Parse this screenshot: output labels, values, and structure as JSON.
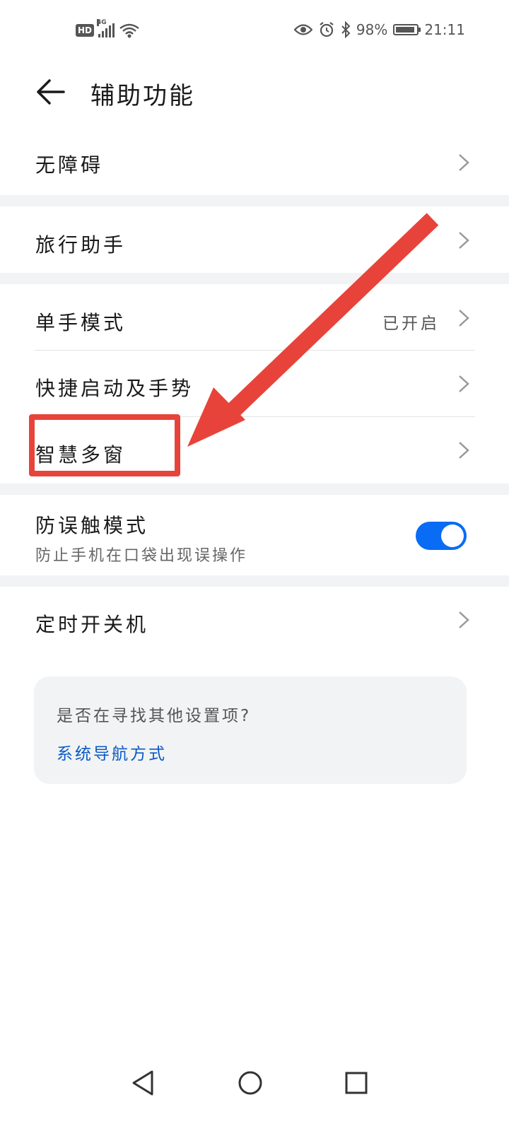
{
  "status_bar": {
    "hd": "HD",
    "network": "4G",
    "battery_percent": "98%",
    "time": "21:11"
  },
  "header": {
    "title": "辅助功能"
  },
  "groups": {
    "accessibility": "无障碍",
    "travel_assistant": "旅行助手",
    "one_hand_mode": {
      "label": "单手模式",
      "status": "已开启"
    },
    "shortcuts_gestures": "快捷启动及手势",
    "smart_multiwindow": "智慧多窗",
    "pocket_mode": {
      "label": "防误触模式",
      "description": "防止手机在口袋出现误操作",
      "enabled": true
    },
    "scheduled_power": "定时开关机"
  },
  "suggestion_card": {
    "question": "是否在寻找其他设置项?",
    "link": "系统导航方式"
  },
  "colors": {
    "accent": "#0a6cf5",
    "link": "#0a59c4",
    "annotation": "#e8433a",
    "separator": "#f1f3f5"
  },
  "icons": {
    "back": "arrow-left-icon",
    "chevron": "chevron-right-icon",
    "nav": [
      "triangle-back-icon",
      "circle-home-icon",
      "square-recent-icon"
    ]
  }
}
